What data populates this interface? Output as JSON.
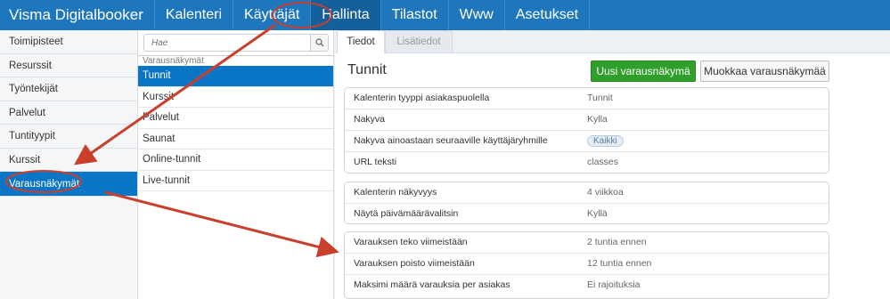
{
  "topbar": {
    "brand": "Visma Digitalbooker",
    "nav": [
      {
        "label": "Kalenteri"
      },
      {
        "label": "Käyttäjät"
      },
      {
        "label": "Hallinta",
        "active": true
      },
      {
        "label": "Tilastot"
      },
      {
        "label": "Www"
      },
      {
        "label": "Asetukset"
      }
    ]
  },
  "sidebar": {
    "items": [
      {
        "label": "Toimipisteet"
      },
      {
        "label": "Resurssit"
      },
      {
        "label": "Työntekijät"
      },
      {
        "label": "Palvelut"
      },
      {
        "label": "Tuntityypit"
      },
      {
        "label": "Kurssit"
      },
      {
        "label": "Varausnäkymät",
        "active": true
      }
    ]
  },
  "middle": {
    "search": {
      "placeholder": "Hae",
      "icon": "search-icon"
    },
    "group_header": "Varausnäkymät",
    "items": [
      {
        "label": "Tunnit",
        "active": true
      },
      {
        "label": "Kurssit"
      },
      {
        "label": "Palvelut"
      },
      {
        "label": "Saunat"
      },
      {
        "label": "Online-tunnit"
      },
      {
        "label": "Live-tunnit"
      }
    ]
  },
  "tabs": [
    {
      "label": "Tiedot",
      "active": true
    },
    {
      "label": "Lisätiedot"
    }
  ],
  "detail": {
    "title": "Tunnit",
    "new_button": "Uusi varausnäkymä",
    "edit_button": "Muokkaa varausnäkymää",
    "group1": [
      {
        "label": "Kalenterin tyyppi asiakaspuolella",
        "value": "Tunnit"
      },
      {
        "label": "Nakyva",
        "value": "Kylla"
      },
      {
        "label": "Nakyva ainoastaan seuraaville käyttäjäryhmille",
        "badge": "Kaikki"
      },
      {
        "label": "URL teksti",
        "value": "classes"
      }
    ],
    "group2": [
      {
        "label": "Kalenterin näkyvyys",
        "value": "4 viikkoa"
      },
      {
        "label": "Näytä päivämäärävalitsin",
        "value": "Kyllä"
      }
    ],
    "group3": [
      {
        "label": "Varauksen teko viimeistään",
        "value": "2 tuntia ennen"
      },
      {
        "label": "Varauksen poisto viimeistään",
        "value": "12 tuntia ennen"
      },
      {
        "label": "Maksimi määrä varauksia per asiakas",
        "value": "Ei rajoituksia"
      }
    ]
  },
  "colors": {
    "topbar": "#1e77bd",
    "active_item": "#0b75c5",
    "primary_button": "#2f9e2a",
    "annotation": "#c8402c"
  }
}
